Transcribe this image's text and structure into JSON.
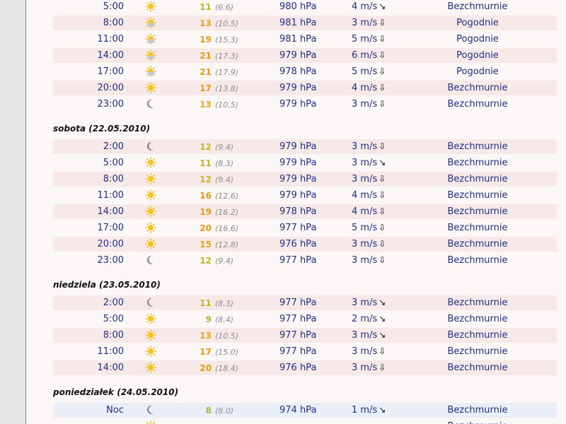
{
  "colors": {
    "page_bg": "#fcf7f7",
    "row_pink": "#f8e9e9",
    "row_blue": "#e9eef7",
    "text_blue": "#1e2f86",
    "feel_gray": "#8c8c8c"
  },
  "pressure_unit": "hPa",
  "wind_unit": "m/s",
  "days": [
    {
      "label": "",
      "rows": [
        {
          "time": "5:00",
          "icon": "sun-icon",
          "temp": "11",
          "feel": "(6.6)",
          "pressure": "980 hPa",
          "wind": "4 m/s",
          "dir": "↘",
          "desc": "Bezchmurnie"
        },
        {
          "time": "8:00",
          "icon": "sun-cloud-icon",
          "temp": "13",
          "feel": "(10.5)",
          "pressure": "981 hPa",
          "wind": "3 m/s",
          "dir": "⇩",
          "desc": "Pogodnie"
        },
        {
          "time": "11:00",
          "icon": "sun-cloud-icon",
          "temp": "19",
          "feel": "(15.3)",
          "pressure": "981 hPa",
          "wind": "5 m/s",
          "dir": "⇩",
          "desc": "Pogodnie"
        },
        {
          "time": "14:00",
          "icon": "sun-cloud-icon",
          "temp": "21",
          "feel": "(17.3)",
          "pressure": "979 hPa",
          "wind": "6 m/s",
          "dir": "⇩",
          "desc": "Pogodnie"
        },
        {
          "time": "17:00",
          "icon": "sun-cloud-icon",
          "temp": "21",
          "feel": "(17.9)",
          "pressure": "978 hPa",
          "wind": "5 m/s",
          "dir": "⇩",
          "desc": "Pogodnie"
        },
        {
          "time": "20:00",
          "icon": "sun-icon",
          "temp": "17",
          "feel": "(13.8)",
          "pressure": "979 hPa",
          "wind": "4 m/s",
          "dir": "⇩",
          "desc": "Bezchmurnie"
        },
        {
          "time": "23:00",
          "icon": "moon-icon",
          "temp": "13",
          "feel": "(10.5)",
          "pressure": "979 hPa",
          "wind": "3 m/s",
          "dir": "⇩",
          "desc": "Bezchmurnie"
        }
      ]
    },
    {
      "label": "sobota (22.05.2010)",
      "rows": [
        {
          "time": "2:00",
          "icon": "moon-icon",
          "temp": "12",
          "feel": "(9.4)",
          "pressure": "979 hPa",
          "wind": "3 m/s",
          "dir": "⇩",
          "desc": "Bezchmurnie"
        },
        {
          "time": "5:00",
          "icon": "sun-icon",
          "temp": "11",
          "feel": "(8.3)",
          "pressure": "979 hPa",
          "wind": "3 m/s",
          "dir": "↘",
          "desc": "Bezchmurnie"
        },
        {
          "time": "8:00",
          "icon": "sun-icon",
          "temp": "12",
          "feel": "(9.4)",
          "pressure": "979 hPa",
          "wind": "3 m/s",
          "dir": "⇩",
          "desc": "Bezchmurnie"
        },
        {
          "time": "11:00",
          "icon": "sun-icon",
          "temp": "16",
          "feel": "(12.6)",
          "pressure": "979 hPa",
          "wind": "4 m/s",
          "dir": "⇩",
          "desc": "Bezchmurnie"
        },
        {
          "time": "14:00",
          "icon": "sun-icon",
          "temp": "19",
          "feel": "(16.2)",
          "pressure": "978 hPa",
          "wind": "4 m/s",
          "dir": "⇩",
          "desc": "Bezchmurnie"
        },
        {
          "time": "17:00",
          "icon": "sun-icon",
          "temp": "20",
          "feel": "(16.6)",
          "pressure": "977 hPa",
          "wind": "5 m/s",
          "dir": "⇩",
          "desc": "Bezchmurnie"
        },
        {
          "time": "20:00",
          "icon": "sun-icon",
          "temp": "15",
          "feel": "(12.8)",
          "pressure": "976 hPa",
          "wind": "3 m/s",
          "dir": "⇩",
          "desc": "Bezchmurnie"
        },
        {
          "time": "23:00",
          "icon": "moon-icon",
          "temp": "12",
          "feel": "(9.4)",
          "pressure": "977 hPa",
          "wind": "3 m/s",
          "dir": "⇩",
          "desc": "Bezchmurnie"
        }
      ]
    },
    {
      "label": "niedziela (23.05.2010)",
      "rows": [
        {
          "time": "2:00",
          "icon": "moon-icon",
          "temp": "11",
          "feel": "(8.3)",
          "pressure": "977 hPa",
          "wind": "3 m/s",
          "dir": "↘",
          "desc": "Bezchmurnie"
        },
        {
          "time": "5:00",
          "icon": "sun-icon",
          "temp": "9",
          "feel": "(8.4)",
          "pressure": "977 hPa",
          "wind": "2 m/s",
          "dir": "↘",
          "desc": "Bezchmurnie"
        },
        {
          "time": "8:00",
          "icon": "sun-icon",
          "temp": "13",
          "feel": "(10.5)",
          "pressure": "977 hPa",
          "wind": "3 m/s",
          "dir": "↘",
          "desc": "Bezchmurnie"
        },
        {
          "time": "11:00",
          "icon": "sun-icon",
          "temp": "17",
          "feel": "(15.0)",
          "pressure": "977 hPa",
          "wind": "3 m/s",
          "dir": "⇩",
          "desc": "Bezchmurnie"
        },
        {
          "time": "14:00",
          "icon": "sun-icon",
          "temp": "20",
          "feel": "(18.4)",
          "pressure": "976 hPa",
          "wind": "3 m/s",
          "dir": "⇩",
          "desc": "Bezchmurnie"
        }
      ]
    },
    {
      "label": "poniedziałek (24.05.2010)",
      "rows": [
        {
          "time": "Noc",
          "icon": "moon-icon",
          "temp": "8",
          "feel": "(8.0)",
          "pressure": "974 hPa",
          "wind": "1 m/s",
          "dir": "↘",
          "desc": "Bezchmurnie"
        },
        {
          "time": "",
          "icon": "sun-icon",
          "temp": "",
          "feel": "",
          "pressure": "",
          "wind": "",
          "dir": "",
          "desc": "Bezchmurnie"
        }
      ]
    }
  ]
}
